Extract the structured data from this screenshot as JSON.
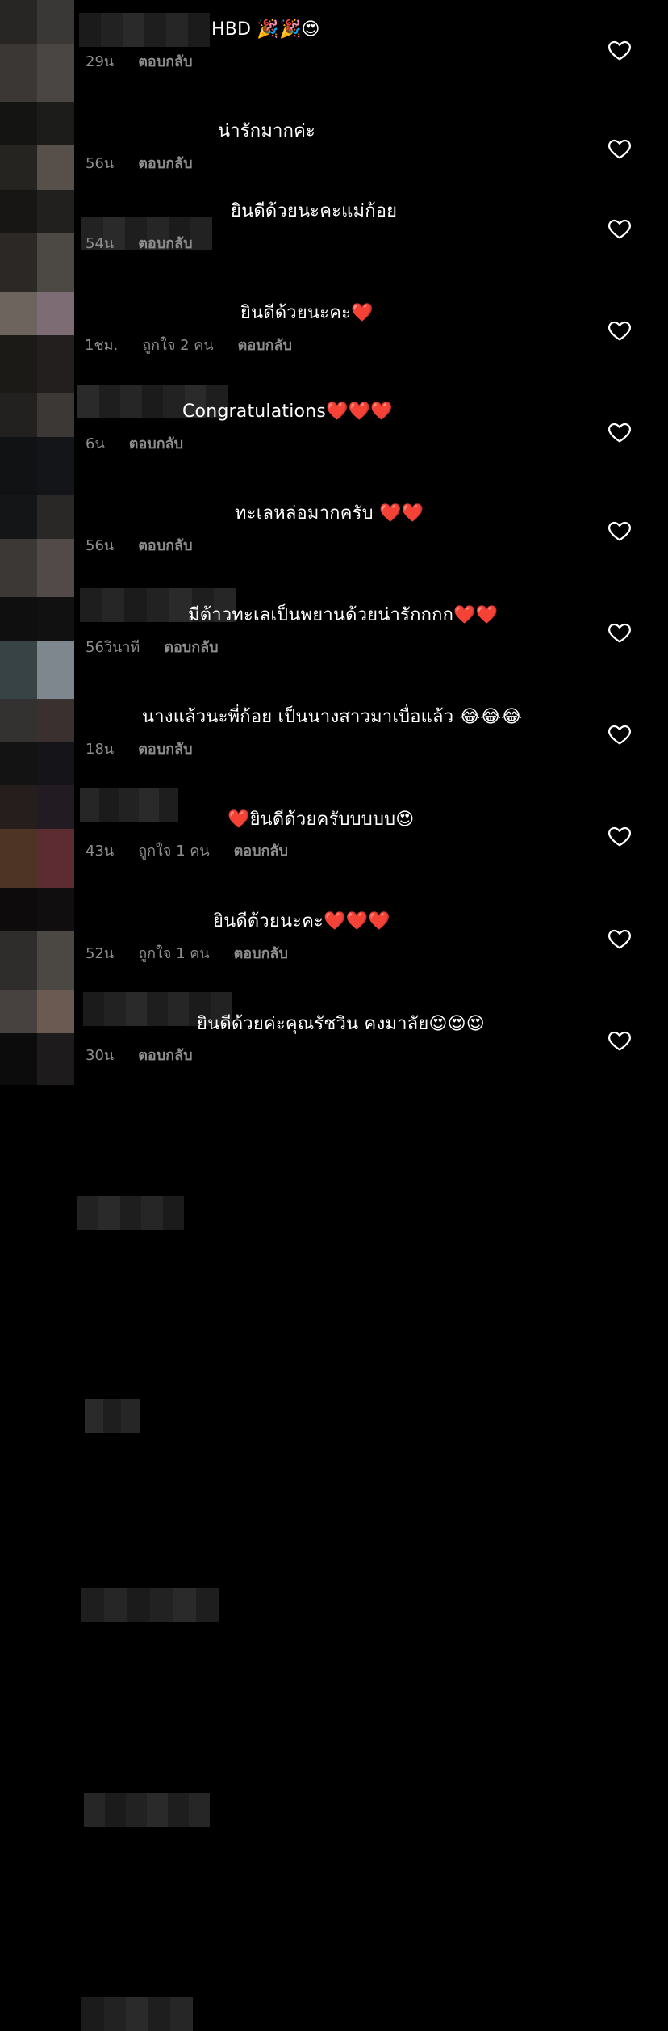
{
  "comments": [
    {
      "text": "HBD 🎉🎉😍",
      "time": "29น",
      "likes": "",
      "reply": "ตอบกลับ"
    },
    {
      "text": "น่ารักมากค่ะ",
      "time": "56น",
      "likes": "",
      "reply": "ตอบกลับ"
    },
    {
      "text": "ยินดีด้วยนะคะแม่ก้อย",
      "time": "54น",
      "likes": "",
      "reply": "ตอบกลับ"
    },
    {
      "text": "ยินดีด้วยนะคะ❤️",
      "time": "1ชม.",
      "likes": "ถูกใจ 2 คน",
      "reply": "ตอบกลับ"
    },
    {
      "text": "Congratulations❤️❤️❤️",
      "time": "6น",
      "likes": "",
      "reply": "ตอบกลับ"
    },
    {
      "text": "ทะเลหล่อมากครับ ❤️❤️",
      "time": "56น",
      "likes": "",
      "reply": "ตอบกลับ"
    },
    {
      "text": "มีต้าวทะเลเป็นพยานด้วยน่ารักกกก❤️❤️",
      "time": "56วินาที",
      "likes": "",
      "reply": "ตอบกลับ"
    },
    {
      "text": "นางแล้วนะพี่ก้อย เป็นนางสาวมาเบื่อแล้ว 😂😂😂",
      "time": "18น",
      "likes": "",
      "reply": "ตอบกลับ"
    },
    {
      "text": "❤️ยินดีด้วยครับบบบบ😍",
      "time": "43น",
      "likes": "ถูกใจ 1 คน",
      "reply": "ตอบกลับ"
    },
    {
      "text": "ยินดีด้วยนะคะ❤️❤️❤️",
      "time": "52น",
      "likes": "ถูกใจ 1 คน",
      "reply": "ตอบกลับ"
    },
    {
      "text": "ยินดีด้วยค่ะคุณรัชวิน คงมาลัย😍😍😍",
      "time": "30น",
      "likes": "",
      "reply": "ตอบกลับ"
    }
  ],
  "icons": {
    "like": "heart-outline-icon"
  },
  "colors": {
    "background": "#000000",
    "text": "#ffffff",
    "meta": "#8e8e8e"
  }
}
